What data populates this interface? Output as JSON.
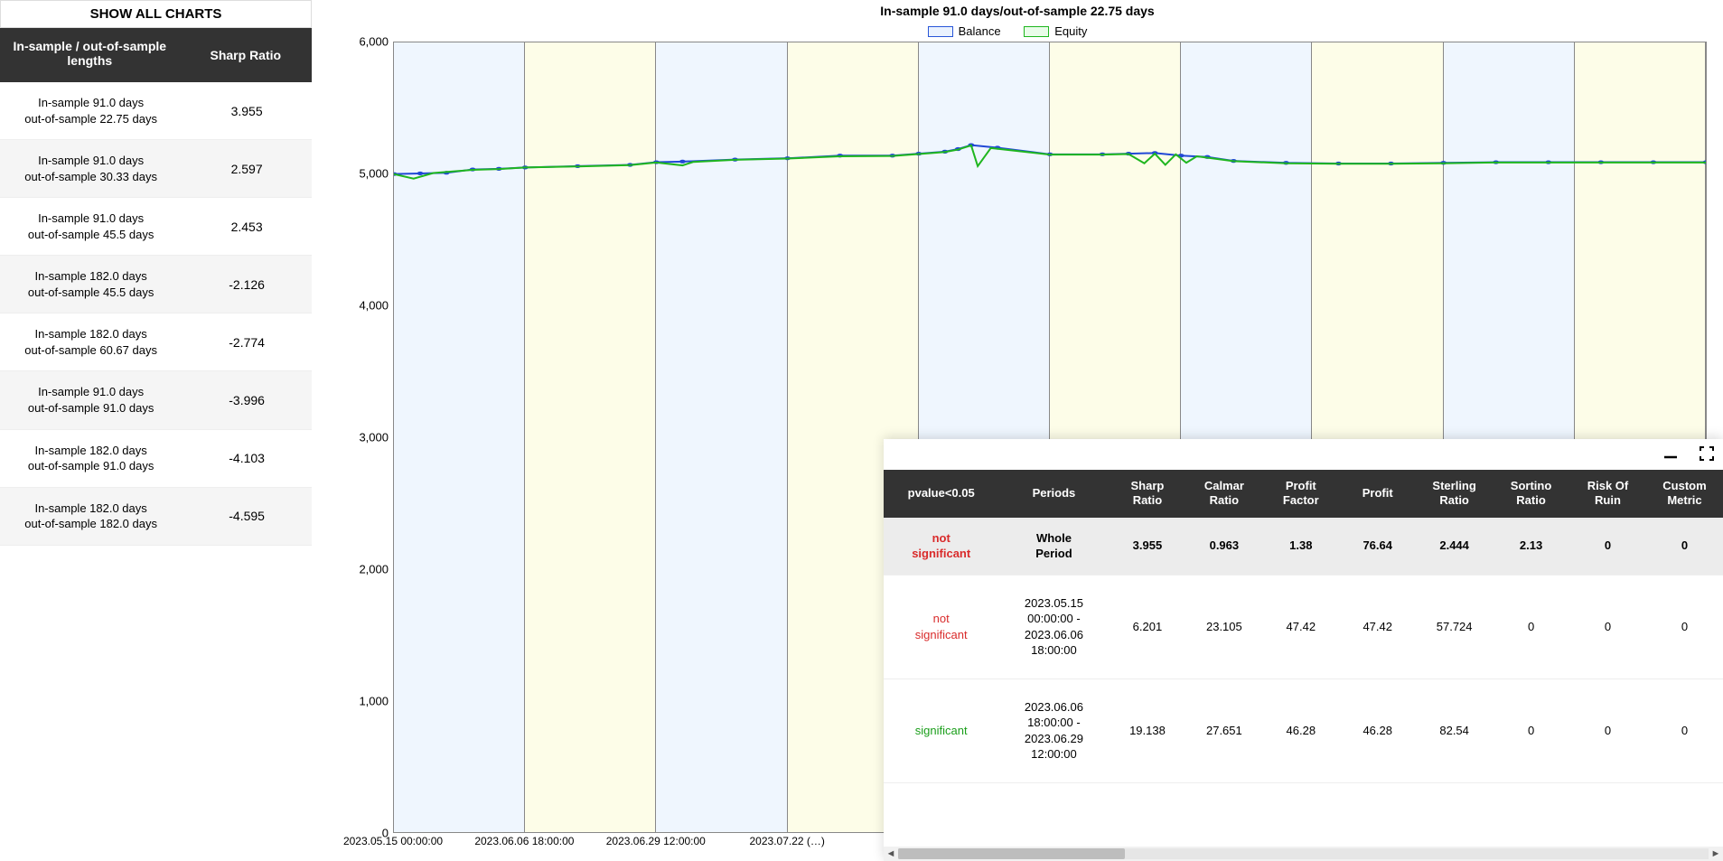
{
  "sidebar": {
    "show_all": "SHOW ALL CHARTS",
    "head_col1": "In-sample / out-of-sample lengths",
    "head_col2": "Sharp Ratio",
    "rows": [
      {
        "label": "In-sample 91.0 days\nout-of-sample 22.75 days",
        "sharp": "3.955"
      },
      {
        "label": "In-sample 91.0 days\nout-of-sample 30.33 days",
        "sharp": "2.597"
      },
      {
        "label": "In-sample 91.0 days\nout-of-sample 45.5 days",
        "sharp": "2.453"
      },
      {
        "label": "In-sample 182.0 days\nout-of-sample 45.5 days",
        "sharp": "-2.126"
      },
      {
        "label": "In-sample 182.0 days\nout-of-sample 60.67 days",
        "sharp": "-2.774"
      },
      {
        "label": "In-sample 91.0 days\nout-of-sample 91.0 days",
        "sharp": "-3.996"
      },
      {
        "label": "In-sample 182.0 days\nout-of-sample 91.0 days",
        "sharp": "-4.103"
      },
      {
        "label": "In-sample 182.0 days\nout-of-sample 182.0 days",
        "sharp": "-4.595"
      }
    ]
  },
  "chart": {
    "title": "In-sample 91.0 days/out-of-sample 22.75 days",
    "legend": {
      "balance": "Balance",
      "equity": "Equity"
    },
    "xaxis": [
      "2023.05.15 00:00:00",
      "2023.06.06 18:00:00",
      "2023.06.29 12:00:00",
      "2023.07.22 (…)"
    ],
    "yaxis": [
      "6,000",
      "5,000",
      "4,000",
      "3,000",
      "2,000",
      "1,000",
      "0"
    ]
  },
  "chart_data": {
    "type": "line",
    "title": "In-sample 91.0 days/out-of-sample 22.75 days",
    "xlabel": "",
    "ylabel": "",
    "ylim": [
      0,
      6000
    ],
    "x_ticks": [
      "2023.05.15 00:00:00",
      "2023.06.06 18:00:00",
      "2023.06.29 12:00:00",
      "2023.07.22"
    ],
    "bands": [
      {
        "type": "in-sample",
        "start": 0.0,
        "end": 0.1,
        "color": "#eff6fe"
      },
      {
        "type": "out-sample",
        "start": 0.1,
        "end": 0.2,
        "color": "#fdfde8"
      },
      {
        "type": "in-sample",
        "start": 0.2,
        "end": 0.3,
        "color": "#eff6fe"
      },
      {
        "type": "out-sample",
        "start": 0.3,
        "end": 0.4,
        "color": "#fdfde8"
      },
      {
        "type": "in-sample",
        "start": 0.4,
        "end": 0.5,
        "color": "#eff6fe"
      },
      {
        "type": "out-sample",
        "start": 0.5,
        "end": 0.6,
        "color": "#fdfde8"
      },
      {
        "type": "in-sample",
        "start": 0.6,
        "end": 0.7,
        "color": "#eff6fe"
      },
      {
        "type": "out-sample",
        "start": 0.7,
        "end": 0.8,
        "color": "#fdfde8"
      },
      {
        "type": "in-sample",
        "start": 0.8,
        "end": 0.9,
        "color": "#eff6fe"
      },
      {
        "type": "out-sample",
        "start": 0.9,
        "end": 1.0,
        "color": "#fdfde8"
      }
    ],
    "series": [
      {
        "name": "Balance",
        "color": "#2148d6",
        "points": [
          [
            0.0,
            5000
          ],
          [
            0.02,
            5005
          ],
          [
            0.04,
            5010
          ],
          [
            0.06,
            5035
          ],
          [
            0.08,
            5040
          ],
          [
            0.1,
            5050
          ],
          [
            0.14,
            5060
          ],
          [
            0.18,
            5070
          ],
          [
            0.2,
            5090
          ],
          [
            0.22,
            5095
          ],
          [
            0.26,
            5110
          ],
          [
            0.3,
            5120
          ],
          [
            0.34,
            5140
          ],
          [
            0.38,
            5140
          ],
          [
            0.4,
            5155
          ],
          [
            0.42,
            5170
          ],
          [
            0.43,
            5190
          ],
          [
            0.44,
            5220
          ],
          [
            0.46,
            5200
          ],
          [
            0.5,
            5150
          ],
          [
            0.54,
            5150
          ],
          [
            0.56,
            5155
          ],
          [
            0.58,
            5160
          ],
          [
            0.6,
            5140
          ],
          [
            0.62,
            5130
          ],
          [
            0.64,
            5100
          ],
          [
            0.68,
            5085
          ],
          [
            0.72,
            5080
          ],
          [
            0.76,
            5080
          ],
          [
            0.8,
            5085
          ],
          [
            0.84,
            5090
          ],
          [
            0.88,
            5090
          ],
          [
            0.92,
            5090
          ],
          [
            0.96,
            5090
          ],
          [
            1.0,
            5090
          ]
        ]
      },
      {
        "name": "Equity",
        "color": "#1fb61f",
        "points": [
          [
            0.0,
            5000
          ],
          [
            0.015,
            4965
          ],
          [
            0.03,
            5008
          ],
          [
            0.06,
            5032
          ],
          [
            0.08,
            5038
          ],
          [
            0.1,
            5050
          ],
          [
            0.14,
            5058
          ],
          [
            0.18,
            5068
          ],
          [
            0.2,
            5088
          ],
          [
            0.22,
            5066
          ],
          [
            0.228,
            5092
          ],
          [
            0.26,
            5108
          ],
          [
            0.3,
            5118
          ],
          [
            0.34,
            5135
          ],
          [
            0.38,
            5138
          ],
          [
            0.4,
            5152
          ],
          [
            0.42,
            5168
          ],
          [
            0.43,
            5186
          ],
          [
            0.44,
            5218
          ],
          [
            0.445,
            5060
          ],
          [
            0.455,
            5198
          ],
          [
            0.5,
            5148
          ],
          [
            0.54,
            5148
          ],
          [
            0.56,
            5152
          ],
          [
            0.572,
            5082
          ],
          [
            0.58,
            5155
          ],
          [
            0.588,
            5070
          ],
          [
            0.596,
            5150
          ],
          [
            0.604,
            5086
          ],
          [
            0.612,
            5135
          ],
          [
            0.64,
            5098
          ],
          [
            0.68,
            5082
          ],
          [
            0.72,
            5078
          ],
          [
            0.76,
            5078
          ],
          [
            0.8,
            5082
          ],
          [
            0.84,
            5088
          ],
          [
            0.88,
            5088
          ],
          [
            0.92,
            5088
          ],
          [
            0.96,
            5088
          ],
          [
            1.0,
            5088
          ]
        ]
      }
    ]
  },
  "panel": {
    "headers": [
      "pvalue<0.05",
      "Periods",
      "Sharp Ratio",
      "Calmar Ratio",
      "Profit Factor",
      "Profit",
      "Sterling Ratio",
      "Sortino Ratio",
      "Risk Of Ruin",
      "Custom Metric"
    ],
    "rows": [
      {
        "pv": "not significant",
        "pv_class": "ns",
        "period": "Whole Period",
        "vals": [
          "3.955",
          "0.963",
          "1.38",
          "76.64",
          "2.444",
          "2.13",
          "0",
          "0"
        ],
        "whole": true
      },
      {
        "pv": "not significant",
        "pv_class": "ns",
        "period": "2023.05.15 00:00:00 - 2023.06.06 18:00:00",
        "vals": [
          "6.201",
          "23.105",
          "47.42",
          "47.42",
          "57.724",
          "0",
          "0",
          "0"
        ]
      },
      {
        "pv": "significant",
        "pv_class": "s",
        "period": "2023.06.06 18:00:00 - 2023.06.29 12:00:00",
        "vals": [
          "19.138",
          "27.651",
          "46.28",
          "46.28",
          "82.54",
          "0",
          "0",
          "0"
        ]
      }
    ]
  }
}
